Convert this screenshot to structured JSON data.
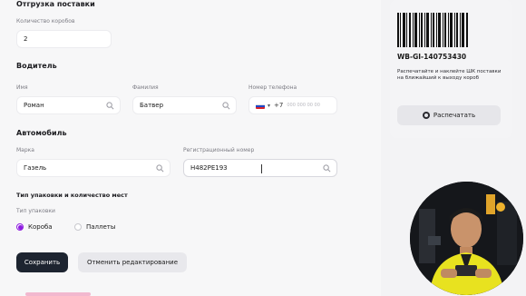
{
  "shipment": {
    "title": "Отгрузка поставки",
    "boxes_label": "Количество коробов",
    "boxes_value": "2"
  },
  "driver": {
    "title": "Водитель",
    "first_name_label": "Имя",
    "first_name_value": "Роман",
    "last_name_label": "Фамилия",
    "last_name_value": "Батвер",
    "phone_label": "Номер телефона",
    "phone_prefix": "+7",
    "phone_placeholder": "000 000 00 00"
  },
  "vehicle": {
    "title": "Автомобиль",
    "brand_label": "Марка",
    "brand_value": "Газель",
    "plate_label": "Регистрационный номер",
    "plate_value": "Н482РЕ193"
  },
  "packaging": {
    "title": "Тип упаковки и количество мест",
    "type_label": "Тип упаковки",
    "options": [
      "Короба",
      "Паллеты"
    ],
    "selected": "Короба"
  },
  "actions": {
    "save_label": "Сохранить",
    "cancel_label": "Отменить редактирование"
  },
  "label_card": {
    "code": "WB-GI-140753430",
    "hint": "Распечатайте и наклейте ШК поставки на ближайший к выходу короб",
    "print_label": "Распечатать"
  },
  "colors": {
    "accent": "#8d1be0",
    "primary_button": "#1d2430"
  },
  "icons": {
    "search": "search-icon",
    "print": "print-icon",
    "flag": "russia-flag-icon",
    "chevron": "chevron-down-icon"
  }
}
